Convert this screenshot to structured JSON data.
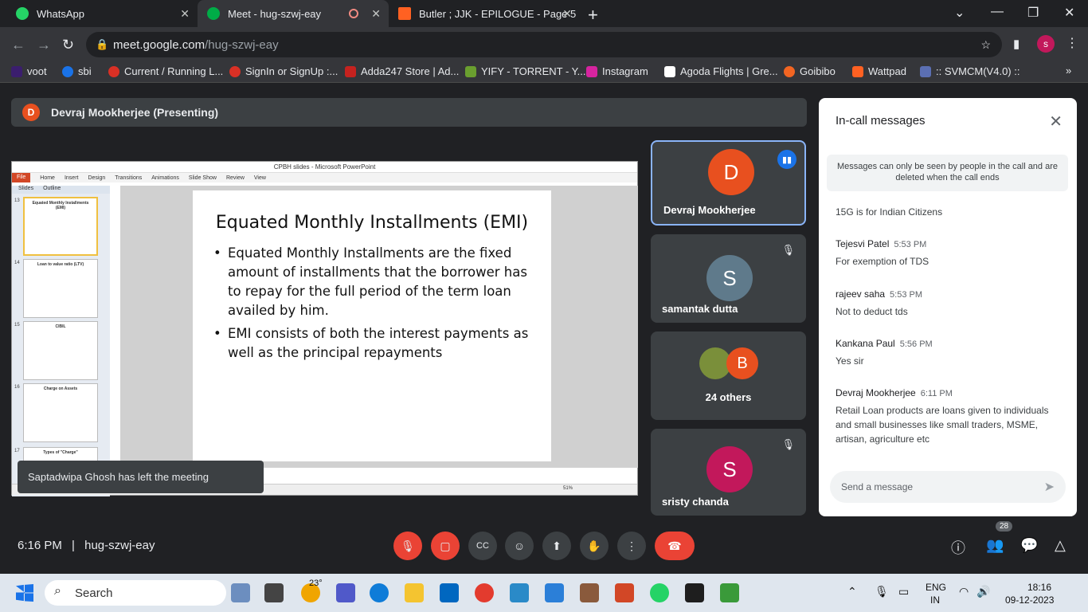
{
  "browser": {
    "tabs": [
      {
        "title": "WhatsApp",
        "color": "#25d366"
      },
      {
        "title": "Meet - hug-szwj-eay",
        "color": "#00ac47"
      },
      {
        "title": "Butler ; JJK - EPILOGUE - Page 5",
        "color": "#ff6122"
      }
    ],
    "url_host": "meet.google.com",
    "url_path": "/hug-szwj-eay",
    "profile_initial": "s",
    "bookmarks": [
      "voot",
      "sbi",
      "Current / Running L...",
      "SignIn or SignUp :...",
      "Adda247 Store | Ad...",
      "YIFY - TORRENT - Y...",
      "Instagram",
      "Agoda Flights | Gre...",
      "Goibibo",
      "Wattpad",
      ":: SVMCM(V4.0) ::"
    ]
  },
  "meet": {
    "presenter_initial": "D",
    "presenter_label": "Devraj Mookherjee (Presenting)",
    "shared_screen": {
      "window_title": "CPBH slides - Microsoft PowerPoint",
      "ribbon_tabs": [
        "File",
        "Home",
        "Insert",
        "Design",
        "Transitions",
        "Animations",
        "Slide Show",
        "Review",
        "View"
      ],
      "pane_tabs": [
        "Slides",
        "Outline"
      ],
      "thumbnails": [
        {
          "num": "13",
          "title": "Equated Monthly Installments (EMI)"
        },
        {
          "num": "14",
          "title": "Loan to value ratio (LTV)"
        },
        {
          "num": "15",
          "title": "CIBIL"
        },
        {
          "num": "16",
          "title": "Charge on Assets"
        },
        {
          "num": "17",
          "title": "Types of \"Charge\""
        }
      ],
      "slide_title": "Equated Monthly Installments (EMI)",
      "bullets": [
        "Equated Monthly Installments are the fixed amount of installments that the borrower has to repay for the full period of the term loan availed by him.",
        "EMI consists of both the interest payments as well as the principal repayments"
      ],
      "zoom": "51%"
    },
    "toast": "Saptadwipa Ghosh has left the meeting",
    "participants": [
      {
        "initial": "D",
        "name": "Devraj Mookherjee",
        "color": "#e8501f"
      },
      {
        "initial": "S",
        "name": "samantak dutta",
        "color": "#5f7a8b"
      },
      {
        "initial": "B",
        "name": "24 others",
        "color": "#e8501f"
      },
      {
        "initial": "S",
        "name": "sristy chanda",
        "color": "#c2185b"
      }
    ],
    "chat": {
      "title": "In-call messages",
      "notice": "Messages can only be seen by people in the call and are deleted when the call ends",
      "messages": [
        {
          "sender": "",
          "time": "",
          "text": "15G is for Indian Citizens"
        },
        {
          "sender": "Tejesvi Patel",
          "time": "5:53 PM",
          "text": "For exemption of TDS"
        },
        {
          "sender": "rajeev saha",
          "time": "5:53 PM",
          "text": "Not to deduct tds"
        },
        {
          "sender": "Kankana Paul",
          "time": "5:56 PM",
          "text": "Yes sir"
        },
        {
          "sender": "Devraj Mookherjee",
          "time": "6:11 PM",
          "text": "Retail Loan products are loans given to individuals and small businesses like small traders, MSME, artisan, agriculture etc"
        }
      ],
      "placeholder": "Send a message"
    },
    "time": "6:16 PM",
    "meeting_code": "hug-szwj-eay",
    "people_count": "28"
  },
  "taskbar": {
    "search": "Search",
    "weather": "23°",
    "lang": "ENG",
    "region": "IN",
    "clock_time": "18:16",
    "clock_date": "09-12-2023"
  }
}
